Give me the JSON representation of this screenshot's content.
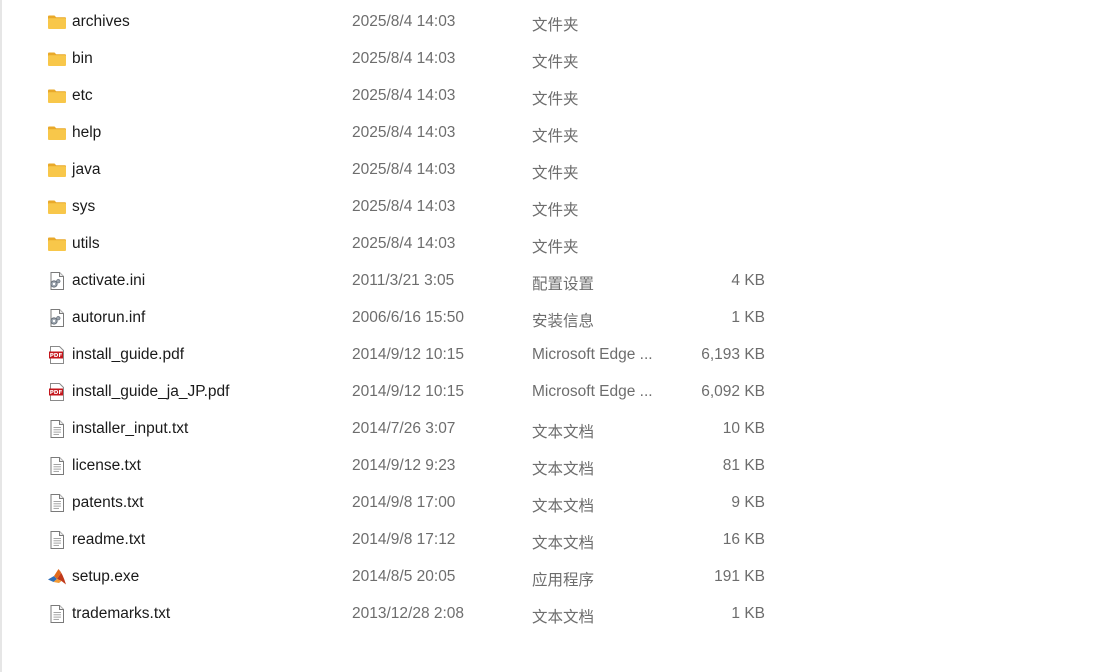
{
  "files": [
    {
      "name": "archives",
      "date": "2025/8/4 14:03",
      "type": "文件夹",
      "size": "",
      "icon": "folder-icon"
    },
    {
      "name": "bin",
      "date": "2025/8/4 14:03",
      "type": "文件夹",
      "size": "",
      "icon": "folder-icon"
    },
    {
      "name": "etc",
      "date": "2025/8/4 14:03",
      "type": "文件夹",
      "size": "",
      "icon": "folder-icon"
    },
    {
      "name": "help",
      "date": "2025/8/4 14:03",
      "type": "文件夹",
      "size": "",
      "icon": "folder-icon"
    },
    {
      "name": "java",
      "date": "2025/8/4 14:03",
      "type": "文件夹",
      "size": "",
      "icon": "folder-icon"
    },
    {
      "name": "sys",
      "date": "2025/8/4 14:03",
      "type": "文件夹",
      "size": "",
      "icon": "folder-icon"
    },
    {
      "name": "utils",
      "date": "2025/8/4 14:03",
      "type": "文件夹",
      "size": "",
      "icon": "folder-icon"
    },
    {
      "name": "activate.ini",
      "date": "2011/3/21 3:05",
      "type": "配置设置",
      "size": "4 KB",
      "icon": "settings-file-icon"
    },
    {
      "name": "autorun.inf",
      "date": "2006/6/16 15:50",
      "type": "安装信息",
      "size": "1 KB",
      "icon": "settings-file-icon"
    },
    {
      "name": "install_guide.pdf",
      "date": "2014/9/12 10:15",
      "type": "Microsoft Edge ...",
      "size": "6,193 KB",
      "icon": "pdf-file-icon"
    },
    {
      "name": "install_guide_ja_JP.pdf",
      "date": "2014/9/12 10:15",
      "type": "Microsoft Edge ...",
      "size": "6,092 KB",
      "icon": "pdf-file-icon"
    },
    {
      "name": "installer_input.txt",
      "date": "2014/7/26 3:07",
      "type": "文本文档",
      "size": "10 KB",
      "icon": "text-file-icon"
    },
    {
      "name": "license.txt",
      "date": "2014/9/12 9:23",
      "type": "文本文档",
      "size": "81 KB",
      "icon": "text-file-icon"
    },
    {
      "name": "patents.txt",
      "date": "2014/9/8 17:00",
      "type": "文本文档",
      "size": "9 KB",
      "icon": "text-file-icon"
    },
    {
      "name": "readme.txt",
      "date": "2014/9/8 17:12",
      "type": "文本文档",
      "size": "16 KB",
      "icon": "text-file-icon"
    },
    {
      "name": "setup.exe",
      "date": "2014/8/5 20:05",
      "type": "应用程序",
      "size": "191 KB",
      "icon": "matlab-app-icon"
    },
    {
      "name": "trademarks.txt",
      "date": "2013/12/28 2:08",
      "type": "文本文档",
      "size": "1 KB",
      "icon": "text-file-icon"
    }
  ],
  "colors": {
    "folder": "#f8c74a",
    "folder_dark": "#e9a92a",
    "pdf_red": "#c4161c",
    "text_primary": "#1a1a1a",
    "text_secondary": "#6d6d6d"
  }
}
